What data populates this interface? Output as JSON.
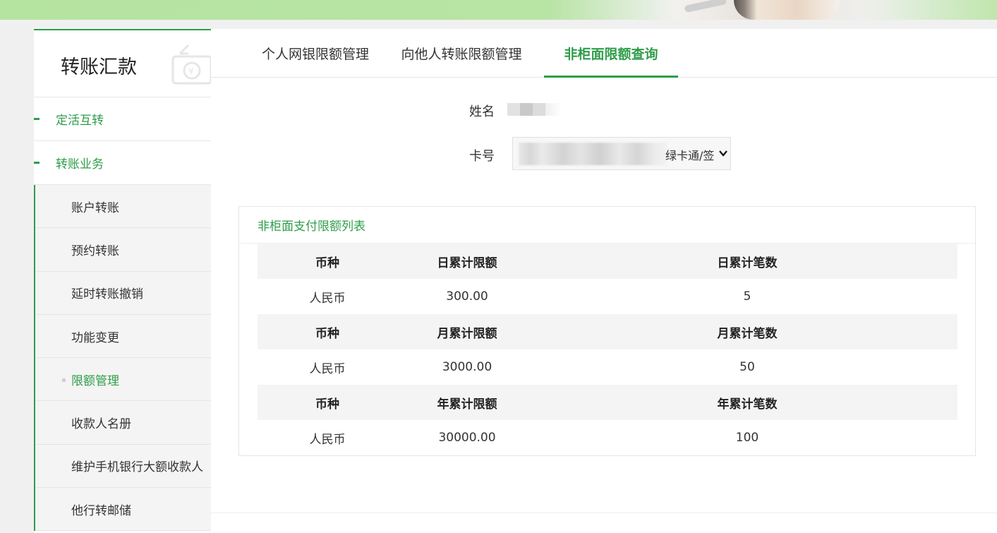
{
  "sidebar": {
    "title": "转账汇款",
    "nav": [
      {
        "label": "定活互转"
      },
      {
        "label": "转账业务"
      }
    ],
    "sub_items": [
      {
        "label": "账户转账"
      },
      {
        "label": "预约转账"
      },
      {
        "label": "延时转账撤销"
      },
      {
        "label": "功能变更"
      },
      {
        "label": "限额管理",
        "active": true
      },
      {
        "label": "收款人名册"
      },
      {
        "label": "维护手机银行大额收款人"
      },
      {
        "label": "他行转邮储"
      }
    ]
  },
  "tabs": [
    {
      "label": "个人网银限额管理"
    },
    {
      "label": "向他人转账限额管理"
    },
    {
      "label": "非柜面限额查询",
      "active": true
    }
  ],
  "form": {
    "name_label": "姓名",
    "card_label": "卡号",
    "card_value_suffix": "绿卡通/签"
  },
  "panel": {
    "title": "非柜面支付限额列表",
    "groups": [
      {
        "headers": [
          "币种",
          "日累计限额",
          "日累计笔数"
        ],
        "values": [
          "人民币",
          "300.00",
          "5"
        ]
      },
      {
        "headers": [
          "币种",
          "月累计限额",
          "月累计笔数"
        ],
        "values": [
          "人民币",
          "3000.00",
          "50"
        ]
      },
      {
        "headers": [
          "币种",
          "年累计限额",
          "年累计笔数"
        ],
        "values": [
          "人民币",
          "30000.00",
          "100"
        ]
      }
    ]
  },
  "colors": {
    "accent": "#2e9d4a",
    "header_bg": "#f4f4f4",
    "banner_green": "#b5e3a0"
  }
}
